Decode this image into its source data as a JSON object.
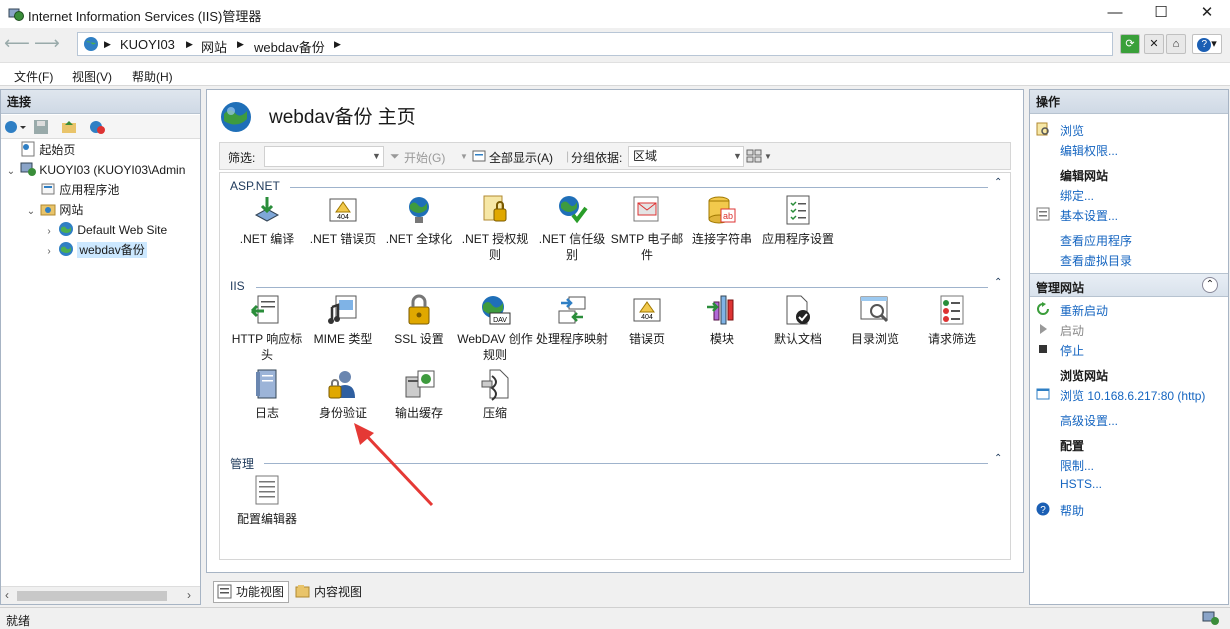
{
  "window": {
    "title": "Internet Information Services (IIS)管理器",
    "minimize": "—",
    "maximize": "☐",
    "close": "✕"
  },
  "address": {
    "crumbs": [
      "KUOYI03",
      "网站",
      "webdav备份"
    ],
    "separator": "▶"
  },
  "menu": [
    "文件(F)",
    "视图(V)",
    "帮助(H)"
  ],
  "connections": {
    "header": "连接",
    "tree": [
      {
        "label": "起始页",
        "icon": "start-page-icon"
      },
      {
        "label": "KUOYI03 (KUOYI03\\Admin",
        "icon": "server-icon"
      },
      {
        "label": "应用程序池",
        "icon": "app-pool-icon"
      },
      {
        "label": "网站",
        "icon": "sites-folder-icon"
      },
      {
        "label": "Default Web Site",
        "icon": "globe-icon"
      },
      {
        "label": "webdav备份",
        "icon": "globe-icon"
      }
    ]
  },
  "center": {
    "page_title": "webdav备份 主页",
    "filter_label": "筛选:",
    "start_label": "开始(G)",
    "show_all_label": "全部显示(A)",
    "group_by_label": "分组依据:",
    "group_by_value": "区域",
    "groups": [
      {
        "name": "ASP.NET",
        "features": [
          {
            "label": ".NET 编译",
            "icon": "net-compile-icon"
          },
          {
            "label": ".NET 错误页",
            "icon": "net-error-page-icon"
          },
          {
            "label": ".NET 全球化",
            "icon": "net-globalization-icon"
          },
          {
            "label": ".NET 授权规则",
            "icon": "net-authorization-icon"
          },
          {
            "label": ".NET 信任级别",
            "icon": "net-trust-icon"
          },
          {
            "label": "SMTP 电子邮件",
            "icon": "smtp-email-icon"
          },
          {
            "label": "连接字符串",
            "icon": "connection-string-icon"
          },
          {
            "label": "应用程序设置",
            "icon": "app-settings-icon"
          }
        ]
      },
      {
        "name": "IIS",
        "features": [
          {
            "label": "HTTP 响应标头",
            "icon": "http-headers-icon"
          },
          {
            "label": "MIME 类型",
            "icon": "mime-types-icon"
          },
          {
            "label": "SSL 设置",
            "icon": "ssl-lock-icon"
          },
          {
            "label": "WebDAV 创作规则",
            "icon": "webdav-icon"
          },
          {
            "label": "处理程序映射",
            "icon": "handler-mappings-icon"
          },
          {
            "label": "错误页",
            "icon": "error-pages-icon"
          },
          {
            "label": "模块",
            "icon": "modules-icon"
          },
          {
            "label": "默认文档",
            "icon": "default-document-icon"
          },
          {
            "label": "目录浏览",
            "icon": "directory-browsing-icon"
          },
          {
            "label": "请求筛选",
            "icon": "request-filtering-icon"
          },
          {
            "label": "日志",
            "icon": "logging-icon"
          },
          {
            "label": "身份验证",
            "icon": "authentication-icon"
          },
          {
            "label": "输出缓存",
            "icon": "output-cache-icon"
          },
          {
            "label": "压缩",
            "icon": "compression-icon"
          }
        ]
      },
      {
        "name": "管理",
        "features": [
          {
            "label": "配置编辑器",
            "icon": "config-editor-icon"
          }
        ]
      }
    ],
    "tabs": [
      "功能视图",
      "内容视图"
    ]
  },
  "actions": {
    "header": "操作",
    "browse": "浏览",
    "edit_permissions": "编辑权限...",
    "edit_site_heading": "编辑网站",
    "bindings": "绑定...",
    "basic_settings": "基本设置...",
    "view_applications": "查看应用程序",
    "view_virtual_dirs": "查看虚拟目录",
    "manage_site_heading": "管理网站",
    "restart": "重新启动",
    "start": "启动",
    "stop": "停止",
    "browse_site_heading": "浏览网站",
    "browse_url": "浏览 10.168.6.217:80 (http)",
    "advanced_settings": "高级设置...",
    "configure_heading": "配置",
    "limits": "限制...",
    "hsts": "HSTS...",
    "help": "帮助"
  },
  "status": {
    "text": "就绪"
  }
}
